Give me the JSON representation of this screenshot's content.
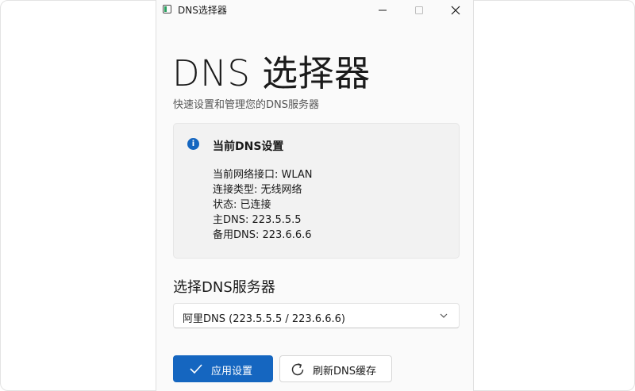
{
  "window": {
    "title": "DNS选择器"
  },
  "header": {
    "title": "DNS 选择器",
    "subtitle": "快速设置和管理您的DNS服务器"
  },
  "info_card": {
    "title": "当前DNS设置",
    "lines": [
      "当前网络接口: WLAN",
      "连接类型: 无线网络",
      "状态: 已连接",
      "主DNS: 223.5.5.5",
      "备用DNS: 223.6.6.6"
    ]
  },
  "selector": {
    "title": "选择DNS服务器",
    "selected": "阿里DNS (223.5.5.5 / 223.6.6.6)"
  },
  "actions": {
    "apply_label": "应用设置",
    "flush_label": "刷新DNS缓存"
  },
  "icons": {
    "app": "app-window-icon",
    "info": "info-icon",
    "dropdown": "chevron-down-icon",
    "apply": "checkmark-icon",
    "flush": "refresh-icon"
  },
  "colors": {
    "accent": "#1566c0",
    "card_background": "#f2f2f2",
    "window_background": "#fafafa"
  }
}
